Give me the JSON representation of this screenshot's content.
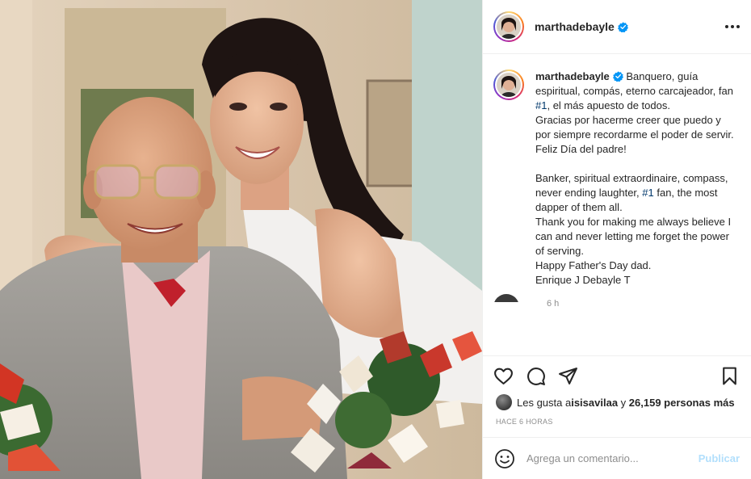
{
  "post": {
    "username": "marthadebayle",
    "caption": {
      "username": "marthadebayle",
      "text_1": "Banquero, guía espiritual, compás, eterno carcajeador, fan ",
      "tag_1": "#1",
      "text_2": ", el más apuesto de todos.\nGracias por hacerme creer que puedo y por siempre recordarme el poder de servir.\nFeliz Día del padre!\n\nBanker, spiritual extraordinaire, compass, never ending laughter, ",
      "tag_2": "#1",
      "text_3": " fan, the most dapper of them all.\nThank you for making me always believe I can and never letting me forget the power of serving.\nHappy Father's Day dad.\nEnrique J Debayle T"
    },
    "time_ago": "6 h",
    "likes": {
      "prefix": "Les gusta a ",
      "user": "isisavilaa",
      "middle": " y ",
      "count": "26,159 personas más"
    },
    "date": "HACE 6 HORAS",
    "comment": {
      "placeholder": "Agrega un comentario...",
      "publish_label": "Publicar"
    }
  },
  "icons": {
    "verified": "verified-badge-icon",
    "more": "more-options-icon",
    "like": "heart-icon",
    "comment": "comment-bubble-icon",
    "share": "paper-plane-icon",
    "save": "bookmark-icon",
    "emoji": "emoji-icon"
  },
  "colors": {
    "link": "#00376b",
    "verified": "#0095f6",
    "publish_disabled": "#b2dffc",
    "muted": "#8e8e8e"
  }
}
